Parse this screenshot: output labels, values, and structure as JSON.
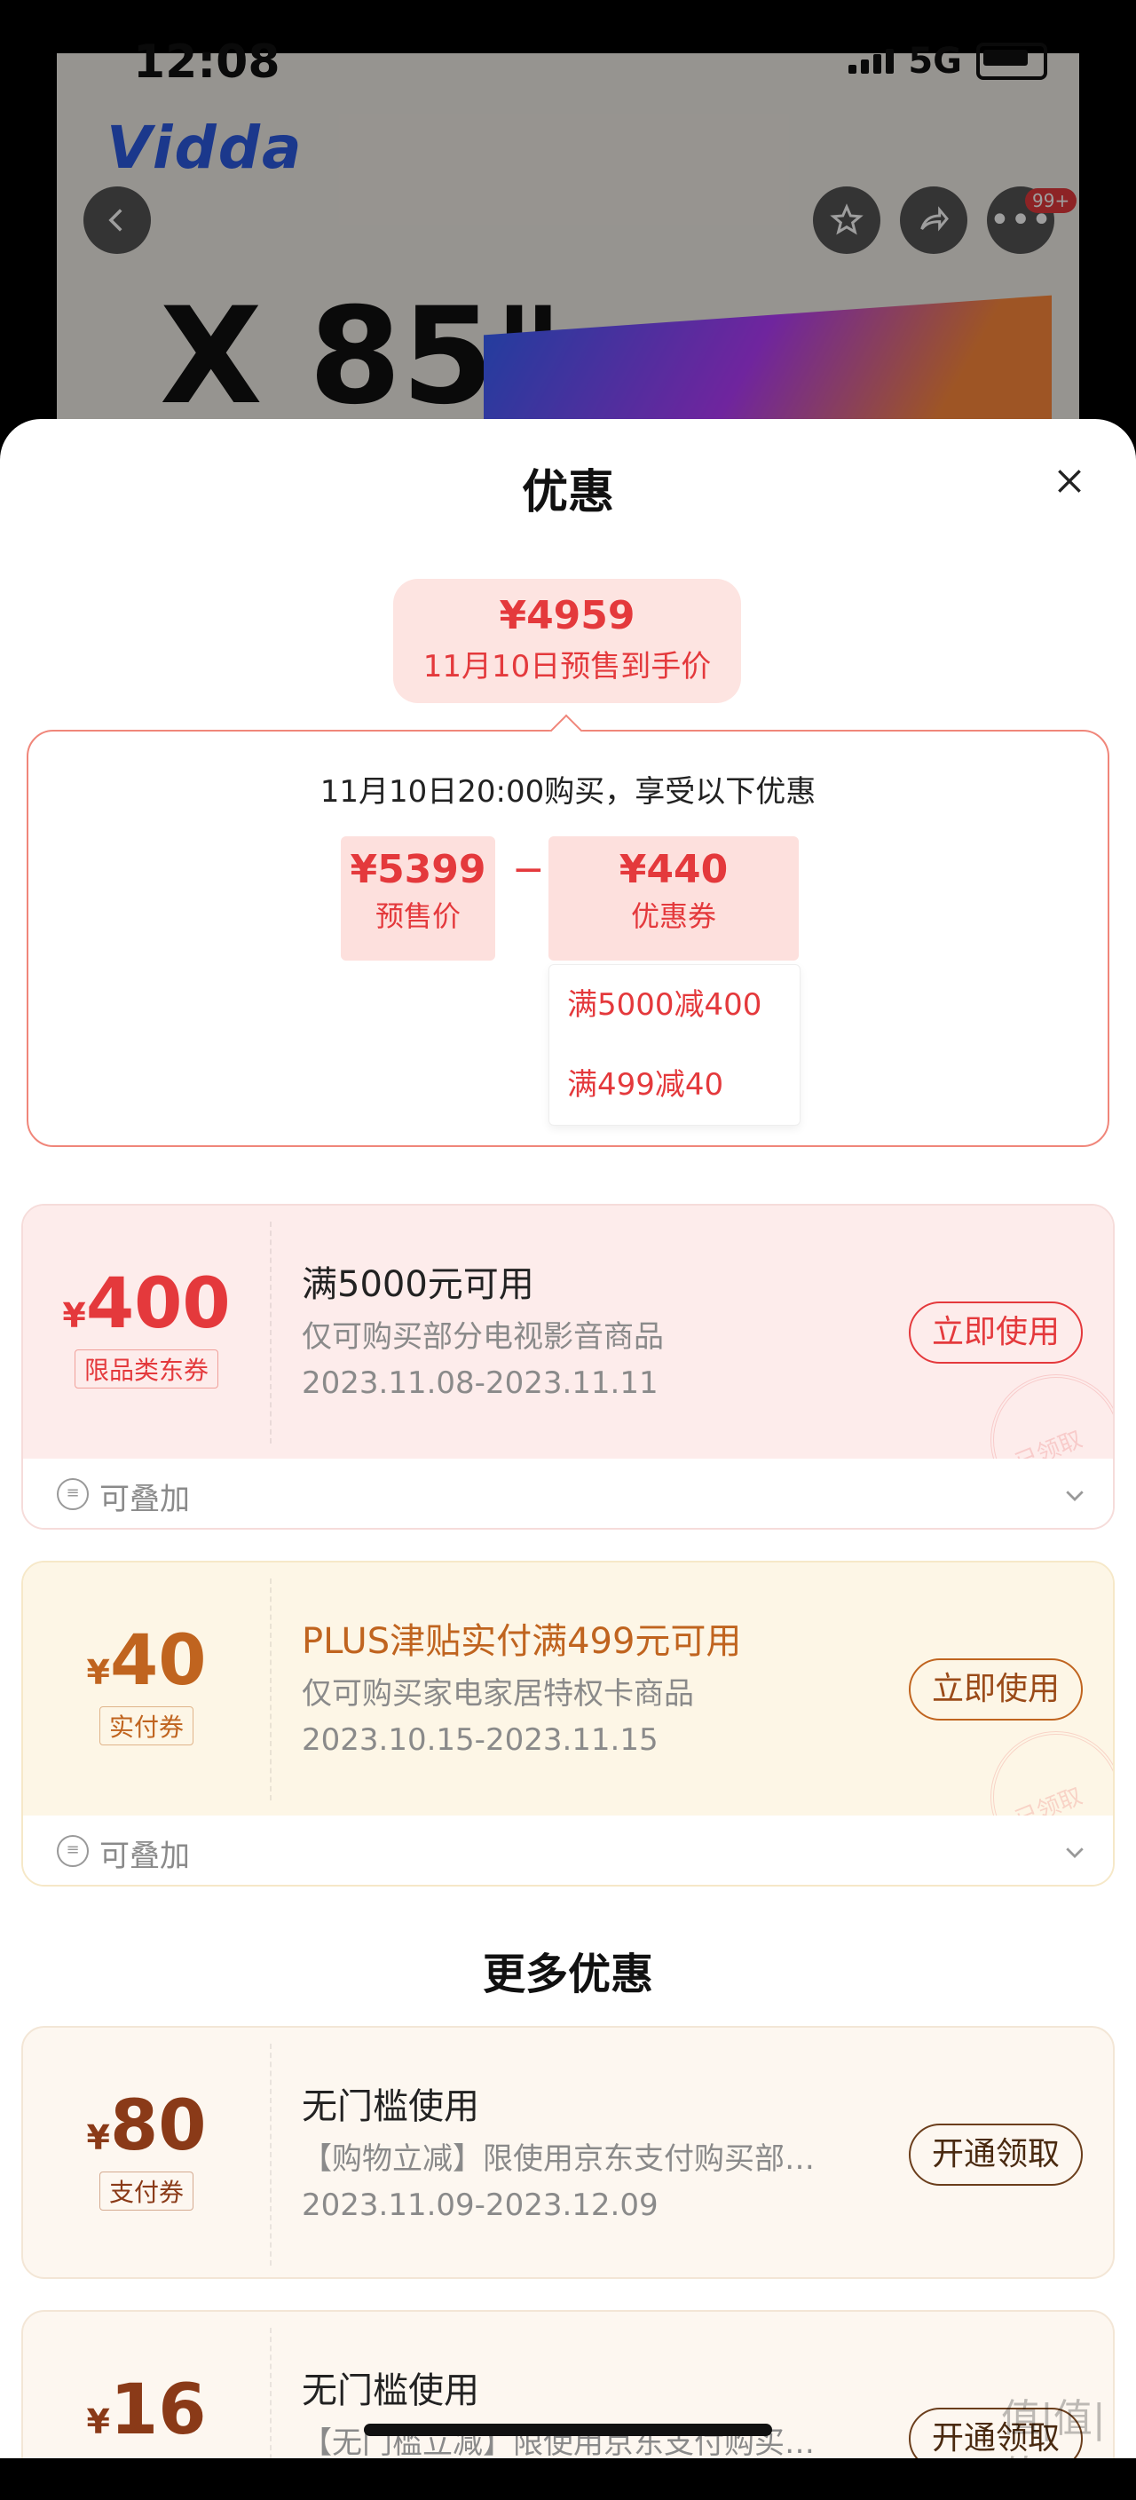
{
  "status_bar": {
    "time": "12:08",
    "network": "5G"
  },
  "background_page": {
    "brand": "Vidda",
    "product_headline": "X 85\"",
    "notification_badge": "99+"
  },
  "sheet": {
    "title": "优惠",
    "price_bubble": {
      "price": "¥4959",
      "label": "11月10日预售到手价"
    },
    "calculation": {
      "title": "11月10日20:00购买，享受以下优惠",
      "presale": {
        "value": "¥5399",
        "label": "预售价"
      },
      "operator": "−",
      "coupon": {
        "value": "¥440",
        "label": "优惠券"
      },
      "breakdown": [
        "满5000减400",
        "满499减40"
      ]
    },
    "coupons": [
      {
        "currency": "¥",
        "amount": "400",
        "tag": "限品类东券",
        "title": "满5000元可用",
        "desc": "仅可购买部分电视影音商品",
        "date": "2023.11.08-2023.11.11",
        "button": "立即使用",
        "stamp": "已领取",
        "stack": "可叠加"
      },
      {
        "currency": "¥",
        "amount": "40",
        "tag": "实付券",
        "title": "PLUS津贴实付满499元可用",
        "desc": "仅可购买家电家居特权卡商品",
        "date": "2023.10.15-2023.11.15",
        "button": "立即使用",
        "stamp": "已领取",
        "stack": "可叠加"
      }
    ],
    "more_title": "更多优惠",
    "more_coupons": [
      {
        "currency": "¥",
        "amount": "80",
        "tag": "支付券",
        "title": "无门槛使用",
        "desc": "【购物立减】限使用京东支付购买部…",
        "date": "2023.11.09-2023.12.09",
        "button": "开通领取"
      },
      {
        "currency": "¥",
        "amount": "16",
        "tag": "",
        "title": "无门槛使用",
        "desc": "【无门槛立减】限使用京东支付购买…",
        "date": "",
        "button": "开通领取"
      }
    ]
  },
  "watermark": "值|值|值",
  "colors": {
    "accent": "#e4393c",
    "gold": "#c0641f",
    "pink_bg": "#fdeceb",
    "yellow_bg": "#fdf6e8",
    "cream_bg": "#fdf7f0"
  }
}
